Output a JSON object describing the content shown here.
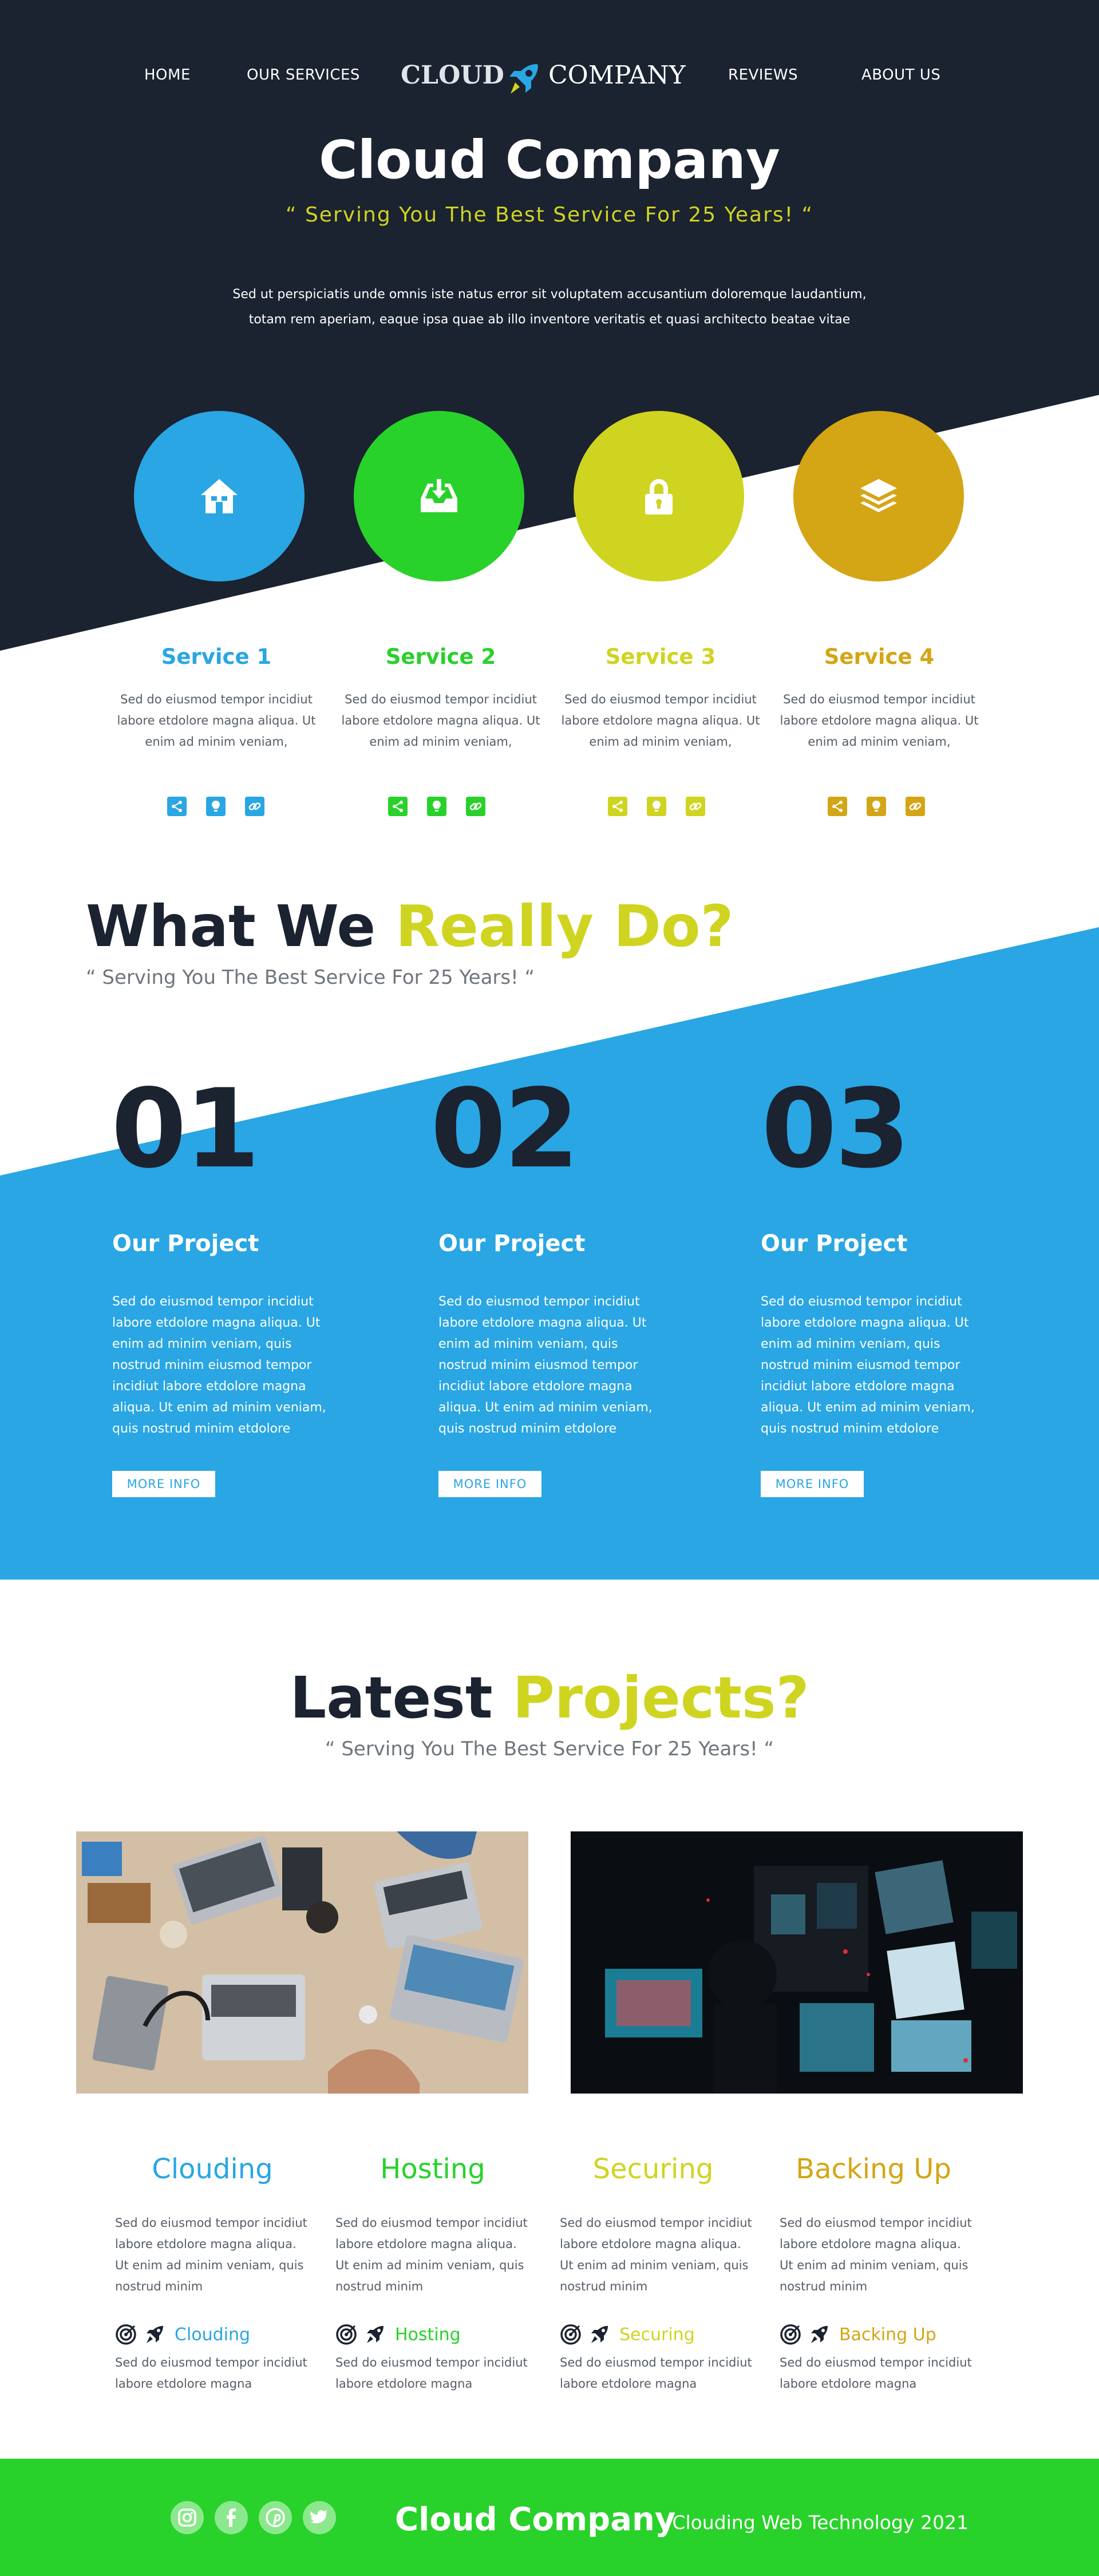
{
  "nav": {
    "links": [
      "HOME",
      "OUR SERVICES",
      "REVIEWS",
      "ABOUT US"
    ],
    "logo_left": "CLOUD",
    "logo_right": "COMPANY",
    "logo_icon": "rocket-icon"
  },
  "hero": {
    "title": "Cloud Company",
    "tagline": "“ Serving You The Best Service For 25 Years! “",
    "paragraph_line1": "Sed ut perspiciatis unde omnis iste natus error sit voluptatem accusantium doloremque laudantium,",
    "paragraph_line2": "totam rem aperiam, eaque ipsa quae ab illo inventore veritatis et quasi architecto beatae vitae"
  },
  "colors": {
    "navy": "#1b2230",
    "blue": "#29a6e3",
    "green": "#29d12b",
    "lime": "#cfd420",
    "gold": "#d4a515"
  },
  "services": [
    {
      "title": "Service 1",
      "text": "Sed do eiusmod tempor incidiut labore etdolore magna aliqua. Ut enim ad minim veniam,",
      "icon": "home-icon",
      "color": "#29a6e3"
    },
    {
      "title": "Service 2",
      "text": "Sed do eiusmod tempor incidiut labore etdolore magna aliqua. Ut enim ad minim veniam,",
      "icon": "inbox-download-icon",
      "color": "#29d12b"
    },
    {
      "title": "Service 3",
      "text": "Sed do eiusmod tempor incidiut labore etdolore magna aliqua. Ut enim ad minim veniam,",
      "icon": "lock-icon",
      "color": "#cfd420"
    },
    {
      "title": "Service 4",
      "text": "Sed do eiusmod tempor incidiut labore etdolore magna aliqua. Ut enim ad minim veniam,",
      "icon": "layers-icon",
      "color": "#d4a515"
    }
  ],
  "service_social_icons": [
    "share-icon",
    "lightbulb-icon",
    "link-icon"
  ],
  "what_we_do": {
    "heading_dark": "What We",
    "heading_accent": "Really Do?",
    "tagline": "“ Serving You The Best Service For 25 Years! “",
    "projects": [
      {
        "number": "01",
        "title": "Our Project",
        "text": "Sed do eiusmod tempor incidiut labore etdolore magna aliqua. Ut enim ad minim veniam, quis nostrud minim eiusmod tempor incidiut labore etdolore magna aliqua. Ut enim ad minim veniam, quis nostrud minim etdolore",
        "button": "MORE INFO"
      },
      {
        "number": "02",
        "title": "Our Project",
        "text": "Sed do eiusmod tempor incidiut labore etdolore magna aliqua. Ut enim ad minim veniam, quis nostrud minim eiusmod tempor incidiut labore etdolore magna aliqua. Ut enim ad minim veniam, quis nostrud minim etdolore",
        "button": "MORE INFO"
      },
      {
        "number": "03",
        "title": "Our Project",
        "text": "Sed do eiusmod tempor incidiut labore etdolore magna aliqua. Ut enim ad minim veniam, quis nostrud minim eiusmod tempor incidiut labore etdolore magna aliqua. Ut enim ad minim veniam, quis nostrud minim etdolore",
        "button": "MORE INFO"
      }
    ]
  },
  "latest": {
    "heading_dark": "Latest",
    "heading_accent": "Projects?",
    "tagline": "“ Serving You The Best Service For 25 Years! “",
    "photos": [
      "desk-with-laptops-photo",
      "neon-screens-photo"
    ]
  },
  "features": [
    {
      "title": "Clouding",
      "text": "Sed do eiusmod tempor incidiut labore etdolore magna aliqua. Ut enim ad minim veniam, quis nostrud minim",
      "label": "Clouding",
      "text2": "Sed do eiusmod tempor incidiut labore etdolore magna",
      "color": "#29a6e3"
    },
    {
      "title": "Hosting",
      "text": "Sed do eiusmod tempor incidiut labore etdolore magna aliqua. Ut enim ad minim veniam, quis nostrud minim",
      "label": "Hosting",
      "text2": "Sed do eiusmod tempor incidiut labore etdolore magna",
      "color": "#29d12b"
    },
    {
      "title": "Securing",
      "text": "Sed do eiusmod tempor incidiut labore etdolore magna aliqua. Ut enim ad minim veniam, quis nostrud minim",
      "label": "Securing",
      "text2": "Sed do eiusmod tempor incidiut labore etdolore magna",
      "color": "#cfd420"
    },
    {
      "title": "Backing Up",
      "text": "Sed do eiusmod tempor incidiut labore etdolore magna aliqua. Ut enim ad minim veniam, quis nostrud minim",
      "label": "Backing Up",
      "text2": "Sed do eiusmod tempor incidiut labore etdolore magna",
      "color": "#d4a515"
    }
  ],
  "feature_row_icons": [
    "target-icon",
    "rocket-icon"
  ],
  "footer": {
    "brand": "Cloud Company",
    "subtitle": "- Clouding Web Technology 2021",
    "social_icons": [
      "instagram-icon",
      "facebook-icon",
      "pinterest-icon",
      "twitter-icon"
    ]
  }
}
